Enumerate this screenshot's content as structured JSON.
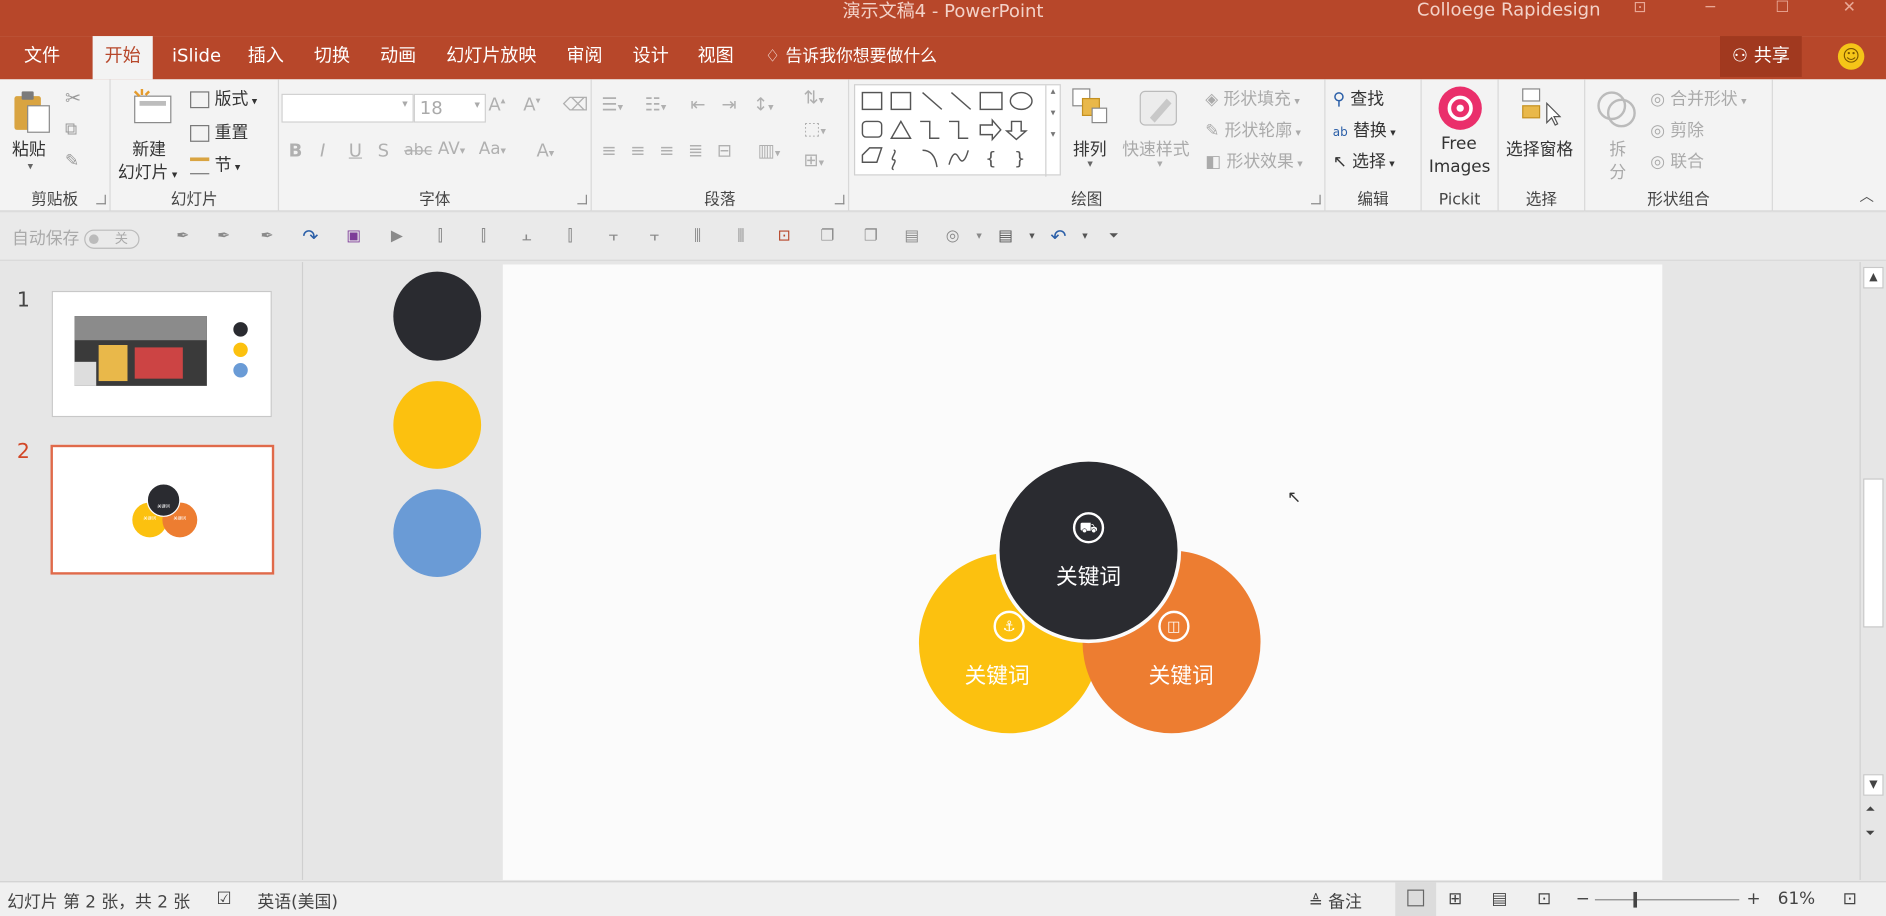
{
  "window": {
    "title": "演示文稿4  -  PowerPoint",
    "user": "Colloege Rapidesign"
  },
  "tabs": [
    "文件",
    "开始",
    "iSlide",
    "插入",
    "切换",
    "动画",
    "幻灯片放映",
    "审阅",
    "设计",
    "视图"
  ],
  "active_tab": "开始",
  "tell_me": "告诉我你想要做什么",
  "share_label": "共享",
  "ribbon": {
    "clipboard": {
      "label": "剪贴板",
      "paste": "粘贴"
    },
    "slides": {
      "label": "幻灯片",
      "new_slide_line1": "新建",
      "new_slide_line2": "幻灯片",
      "layout": "版式",
      "reset": "重置",
      "section": "节"
    },
    "font": {
      "label": "字体",
      "font_size": "18"
    },
    "paragraph": {
      "label": "段落"
    },
    "drawing": {
      "label": "绘图",
      "arrange": "排列",
      "quick_styles": "快速样式",
      "shape_fill": "形状填充",
      "shape_outline": "形状轮廓",
      "shape_effects": "形状效果"
    },
    "editing": {
      "label": "编辑",
      "find": "查找",
      "replace": "替换",
      "select": "选择"
    },
    "pickit": {
      "label": "Pickit",
      "btn_line1": "Free",
      "btn_line2": "Images"
    },
    "selection": {
      "label": "选择",
      "pane": "选择窗格"
    },
    "shape_combine": {
      "label": "形状组合",
      "split_line1": "拆",
      "split_line2": "分",
      "merge": "合并形状",
      "cut": "剪除",
      "union": "联合"
    }
  },
  "qat": {
    "autosave": "自动保存",
    "autosave_state": "关"
  },
  "slides": [
    {
      "number": "1"
    },
    {
      "number": "2"
    }
  ],
  "selected_slide": 2,
  "palette": [
    "#2a2b30",
    "#fcc10f",
    "#6a9bd6"
  ],
  "diagram": {
    "top": {
      "label": "关键词",
      "color": "#2a2b30",
      "icon": "truck-icon"
    },
    "left": {
      "label": "关键词",
      "color": "#fcc10f",
      "icon": "anchor-icon"
    },
    "right": {
      "label": "关键词",
      "color": "#ed7d31",
      "icon": "presentation-icon"
    }
  },
  "thumb2_labels": {
    "top": "关键词",
    "left": "关键词",
    "right": "关键词"
  },
  "status": {
    "slide_info": "幻灯片 第 2 张，共 2 张",
    "language": "英语(美国)",
    "notes": "备注",
    "zoom": "61%"
  }
}
